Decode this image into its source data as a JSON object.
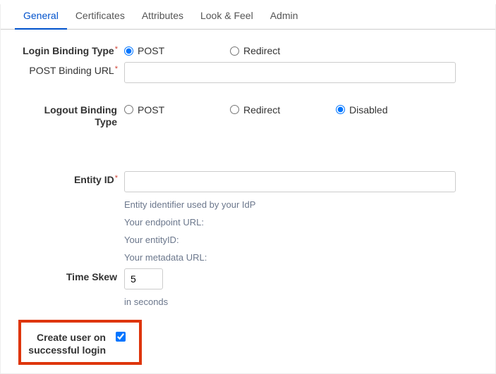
{
  "tabs": {
    "general": "General",
    "certificates": "Certificates",
    "attributes": "Attributes",
    "lookfeel": "Look & Feel",
    "admin": "Admin"
  },
  "labels": {
    "login_binding_type": "Login Binding Type",
    "post_binding_url": "POST Binding URL",
    "logout_binding_type": "Logout Binding Type",
    "entity_id": "Entity ID",
    "time_skew": "Time Skew",
    "create_user": "Create user on successful login"
  },
  "options": {
    "post": "POST",
    "redirect": "Redirect",
    "disabled": "Disabled"
  },
  "help": {
    "entity_identifier": "Entity identifier used by your IdP",
    "endpoint_url": "Your endpoint URL:",
    "your_entity_id": "Your entityID:",
    "metadata_url": "Your metadata URL:",
    "in_seconds": "in seconds"
  },
  "values": {
    "time_skew": "5"
  }
}
